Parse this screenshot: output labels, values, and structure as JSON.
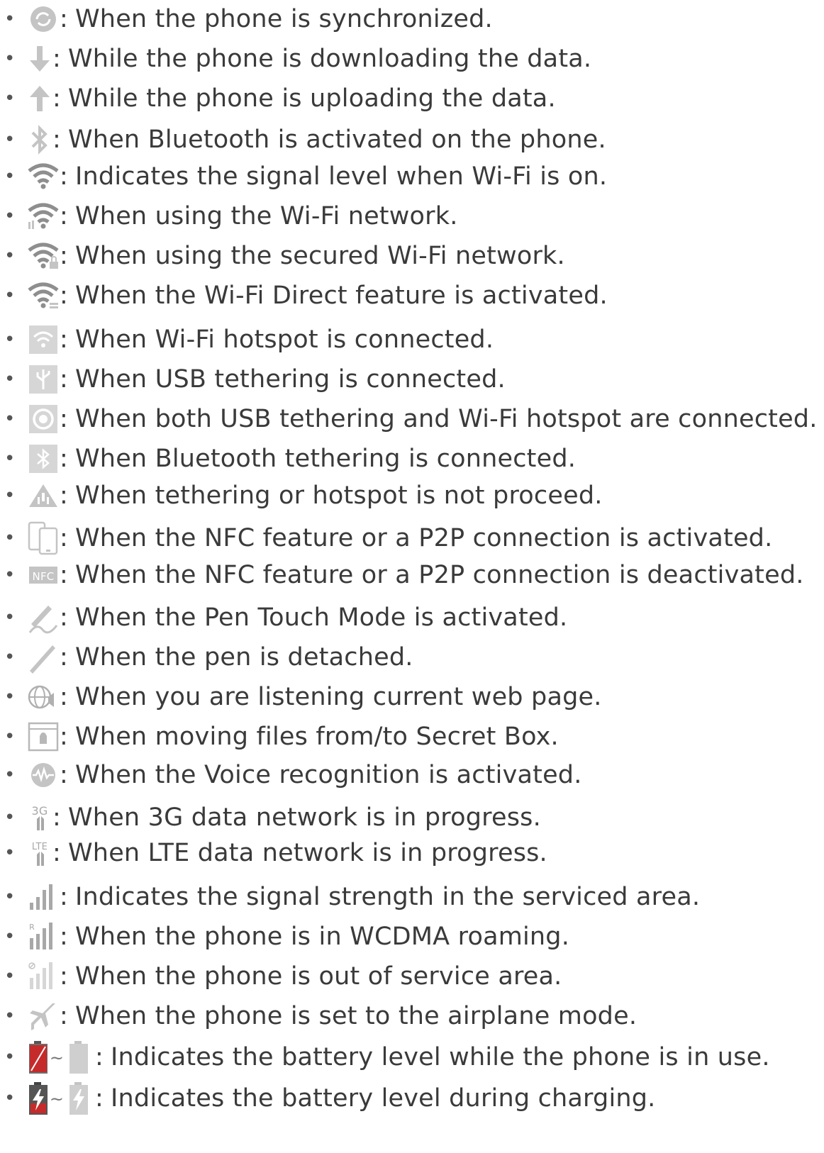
{
  "items": [
    {
      "icon": "sync-icon",
      "text": "When the phone is synchronized."
    },
    {
      "icon": "download-icon",
      "text": "While the phone is downloading the data."
    },
    {
      "icon": "upload-icon",
      "text": "While the phone is uploading the data."
    },
    {
      "icon": "bluetooth-icon",
      "text": "When Bluetooth is activated on the phone."
    },
    {
      "icon": "wifi-signal-icon",
      "text": "Indicates the signal level when Wi-Fi is on."
    },
    {
      "icon": "wifi-network-icon",
      "text": "When using the Wi-Fi network."
    },
    {
      "icon": "wifi-secured-icon",
      "text": "When using the secured Wi-Fi network."
    },
    {
      "icon": "wifi-direct-icon",
      "text": "When the Wi-Fi Direct feature is activated."
    },
    {
      "icon": "wifi-hotspot-icon",
      "text": "When Wi-Fi hotspot is connected."
    },
    {
      "icon": "usb-tethering-icon",
      "text": "When USB tethering is connected."
    },
    {
      "icon": "usb-and-hotspot-icon",
      "text": "When both USB tethering and Wi-Fi hotspot are connected."
    },
    {
      "icon": "bluetooth-tethering-icon",
      "text": "When Bluetooth tethering is connected."
    },
    {
      "icon": "tethering-warning-icon",
      "text": "When tethering or hotspot is not proceed."
    },
    {
      "icon": "nfc-p2p-icon",
      "text": "When the NFC feature or a P2P connection is activated."
    },
    {
      "icon": "nfc-off-icon",
      "text": "When the NFC feature or a P2P connection is deactivated."
    },
    {
      "icon": "pen-touch-icon",
      "text": "When the Pen Touch Mode is activated."
    },
    {
      "icon": "pen-detached-icon",
      "text": "When the pen is detached."
    },
    {
      "icon": "web-listen-icon",
      "text": "When you are listening current web page."
    },
    {
      "icon": "secret-box-icon",
      "text": "When moving files from/to Secret Box."
    },
    {
      "icon": "voice-recognition-icon",
      "text": "When the Voice recognition is activated."
    },
    {
      "icon": "3g-icon",
      "text": "When 3G data network is in progress."
    },
    {
      "icon": "lte-icon",
      "text": "When LTE data network is in progress."
    },
    {
      "icon": "signal-strength-icon",
      "text": "Indicates the signal strength in the serviced area."
    },
    {
      "icon": "roaming-icon",
      "text": "When the phone is in WCDMA roaming."
    },
    {
      "icon": "no-service-icon",
      "text": "When the phone is out of service area."
    },
    {
      "icon": "airplane-icon",
      "text": "When the phone is set to the airplane mode."
    },
    {
      "icon": "battery-level-icon",
      "text": "Indicates the battery level while the phone is in use."
    },
    {
      "icon": "battery-charging-icon",
      "text": "Indicates the battery level during charging."
    }
  ],
  "bullet": "•",
  "colon": ":",
  "icon_glyphs": {
    "3g": "3G",
    "lte": "LTE",
    "nfc": "NFC",
    "roaming": "R",
    "tilde": "~"
  },
  "colors": {
    "icon_gray": "#b9b9b9",
    "icon_dark": "#8e8e8e",
    "text": "#3a3a3a",
    "battery_red": "#c62b2b",
    "battery_dark": "#555555"
  }
}
